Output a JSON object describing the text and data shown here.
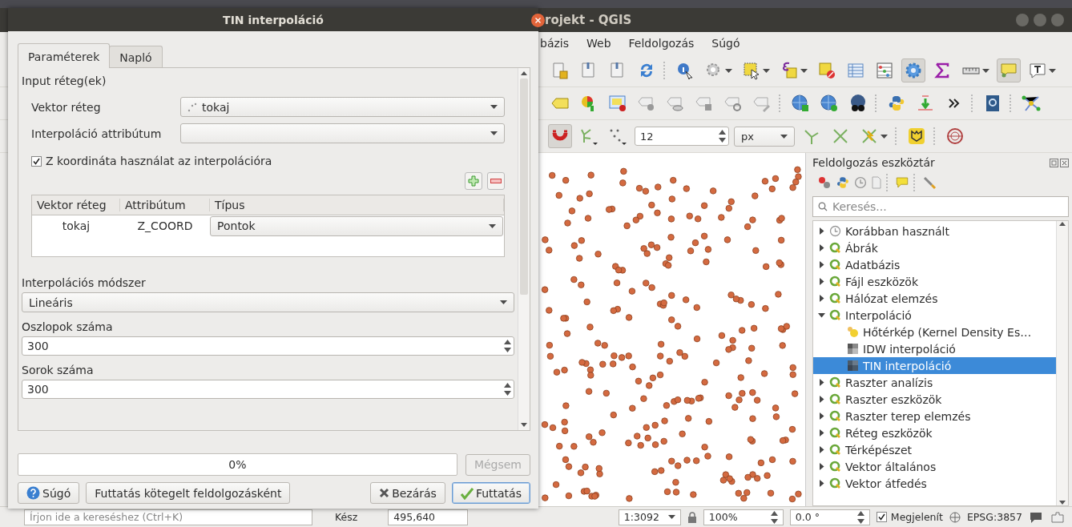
{
  "main_window": {
    "title": "rojekt - QGIS",
    "menu": [
      "bázis",
      "Web",
      "Feldolgozás",
      "Súgó"
    ],
    "snap_tolerance": "12",
    "snap_unit": "px"
  },
  "processing_panel": {
    "title": "Feldolgozás eszköztár",
    "search": {
      "placeholder": "Keresés..."
    },
    "tree": [
      {
        "label": "Korábban használt",
        "kind": "recent",
        "expanded": false,
        "selected": false
      },
      {
        "label": "Ábrák",
        "kind": "group",
        "expanded": false,
        "selected": false
      },
      {
        "label": "Adatbázis",
        "kind": "group",
        "expanded": false,
        "selected": false
      },
      {
        "label": "Fájl eszközök",
        "kind": "group",
        "expanded": false,
        "selected": false
      },
      {
        "label": "Hálózat elemzés",
        "kind": "group",
        "expanded": false,
        "selected": false
      },
      {
        "label": "Interpoláció",
        "kind": "group",
        "expanded": true,
        "selected": false,
        "children": [
          {
            "label": "Hőtérkép (Kernel Density Es…",
            "kind": "heatmap",
            "selected": false
          },
          {
            "label": "IDW interpoláció",
            "kind": "idw",
            "selected": false
          },
          {
            "label": "TIN interpoláció",
            "kind": "tin",
            "selected": true
          }
        ]
      },
      {
        "label": "Raszter analízis",
        "kind": "group",
        "expanded": false,
        "selected": false
      },
      {
        "label": "Raszter eszközök",
        "kind": "group",
        "expanded": false,
        "selected": false
      },
      {
        "label": "Raszter terep elemzés",
        "kind": "group",
        "expanded": false,
        "selected": false
      },
      {
        "label": "Réteg eszközök",
        "kind": "group",
        "expanded": false,
        "selected": false
      },
      {
        "label": "Térképészet",
        "kind": "group",
        "expanded": false,
        "selected": false
      },
      {
        "label": "Vektor általános",
        "kind": "group",
        "expanded": false,
        "selected": false
      },
      {
        "label": "Vektor átfedés",
        "kind": "group",
        "expanded": false,
        "selected": false
      }
    ]
  },
  "status_bar": {
    "search_placeholder": "Írjon ide a kereséshez (Ctrl+K)",
    "message": "Kész",
    "coordinate": "495,640",
    "scale": "1:3092",
    "magnifier": "100%",
    "rotation": "0.0 °",
    "render": {
      "label": "Megjelenít",
      "checked": true
    },
    "crs": "EPSG:3857"
  },
  "dialog": {
    "title": "TIN interpoláció",
    "tabs": [
      {
        "label": "Paraméterek",
        "selected": true
      },
      {
        "label": "Napló",
        "selected": false
      }
    ],
    "section_label": "Input réteg(ek)",
    "vector_layer": {
      "label": "Vektor réteg",
      "value": "tokaj"
    },
    "attribute": {
      "label": "Interpoláció attribútum"
    },
    "use_z": {
      "label": "Z koordináta használat az interpolációra",
      "checked": true
    },
    "layers_table": {
      "columns": [
        "Vektor réteg",
        "Attribútum",
        "Típus"
      ],
      "rows": [
        {
          "layer": "tokaj",
          "attribute": "Z_COORD",
          "type": "Pontok"
        }
      ]
    },
    "method": {
      "label": "Interpolációs módszer",
      "value": "Lineáris"
    },
    "columns_count": {
      "label": "Oszlopok száma",
      "value": "300"
    },
    "rows_count": {
      "label": "Sorok száma",
      "value": "300"
    },
    "progress": {
      "level": 0,
      "text": "0%"
    },
    "cancel": {
      "label": "Mégsem",
      "disabled": true
    },
    "buttons": [
      {
        "label": "Súgó",
        "kind": "help"
      },
      {
        "label": "Futtatás kötegelt feldolgozásként",
        "kind": "plain"
      },
      {
        "label": "Bezárás",
        "kind": "close"
      },
      {
        "label": "Futtatás",
        "kind": "run"
      }
    ]
  }
}
